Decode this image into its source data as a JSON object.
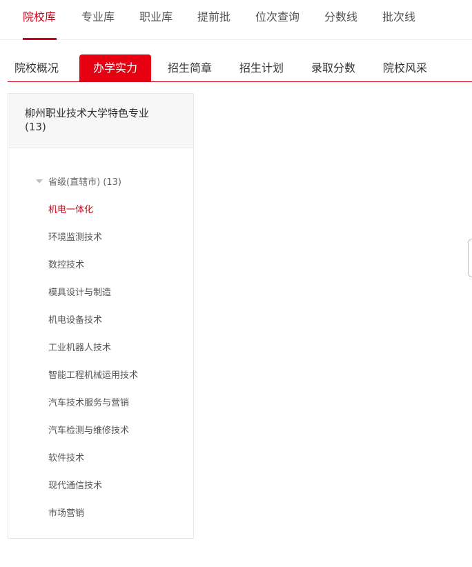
{
  "top_nav": {
    "items": [
      "院校库",
      "专业库",
      "职业库",
      "提前批",
      "位次查询",
      "分数线",
      "批次线"
    ],
    "active_index": 0
  },
  "tabs": {
    "items": [
      "院校概况",
      "办学实力",
      "招生简章",
      "招生计划",
      "录取分数",
      "院校风采"
    ],
    "active_index": 1
  },
  "panel": {
    "title": "柳州职业技术大学特色专业",
    "count": "(13)",
    "tree": {
      "root_label": "省级(直辖市) (13)",
      "majors": [
        "机电一体化",
        "环境监测技术",
        "数控技术",
        "模具设计与制造",
        "机电设备技术",
        "工业机器人技术",
        "智能工程机械运用技术",
        "汽车技术服务与营销",
        "汽车检测与维修技术",
        "软件技术",
        "现代通信技术",
        "市场营销"
      ],
      "active_index": 0
    }
  },
  "colors": {
    "accent": "#d0021b",
    "active_tab_bg": "#e60012"
  }
}
